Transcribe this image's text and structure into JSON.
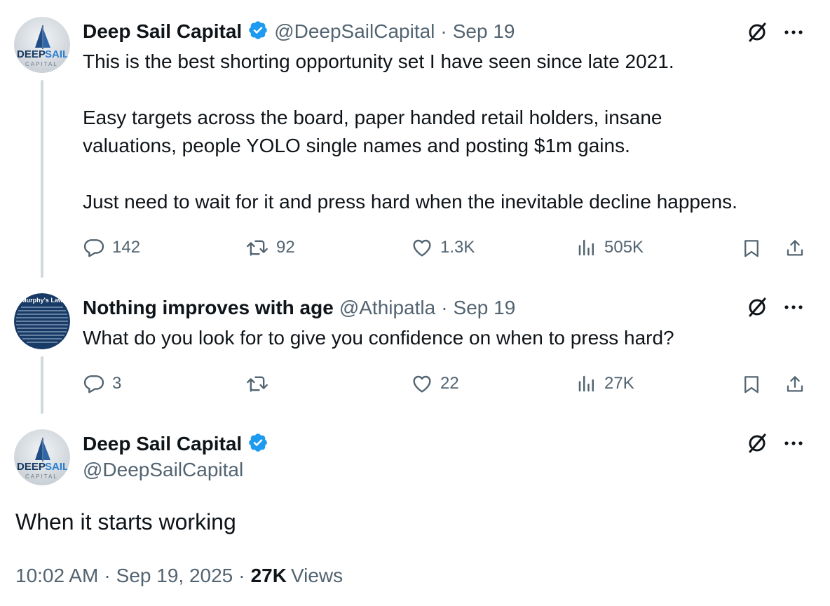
{
  "tweets": [
    {
      "author": {
        "name": "Deep Sail Capital",
        "handle": "@DeepSailCapital",
        "verified": true,
        "avatar_text": {
          "line1a": "DEEP",
          "line1b": "SAIL",
          "line2": "CAPITAL"
        }
      },
      "separator": "·",
      "date": "Sep 19",
      "text": [
        "This is the best shorting opportunity set I have seen since late 2021.",
        "Easy targets across the board, paper handed retail holders, insane",
        "valuations, people YOLO single names and posting $1m gains.",
        "Just need to wait for it and press hard when the inevitable decline happens."
      ],
      "stats": {
        "replies": "142",
        "reposts": "92",
        "likes": "1.3K",
        "views": "505K"
      }
    },
    {
      "author": {
        "name": "Nothing improves with age",
        "handle": "@Athipatla",
        "verified": false,
        "avatar_text": {
          "title": "Murphy's Law"
        }
      },
      "separator": "·",
      "date": "Sep 19",
      "text": [
        "What do you look for to give you confidence on when to press hard?"
      ],
      "stats": {
        "replies": "3",
        "reposts": "",
        "likes": "22",
        "views": "27K"
      }
    }
  ],
  "main_tweet": {
    "author": {
      "name": "Deep Sail Capital",
      "handle": "@DeepSailCapital",
      "verified": true,
      "avatar_text": {
        "line1a": "DEEP",
        "line1b": "SAIL",
        "line2": "CAPITAL"
      }
    },
    "text": "When it starts working",
    "time": "10:02 AM",
    "separator": "·",
    "date": "Sep 19, 2025",
    "separator2": "·",
    "views_count": "27K",
    "views_label": "Views"
  },
  "colors": {
    "verified": "#1d9bf0",
    "muted": "#536471",
    "text": "#0f1419",
    "line": "#cfd9de"
  },
  "icons": [
    "reply-icon",
    "repost-icon",
    "like-icon",
    "views-icon",
    "bookmark-icon",
    "share-icon",
    "grok-icon",
    "more-icon",
    "verified-badge-icon"
  ]
}
